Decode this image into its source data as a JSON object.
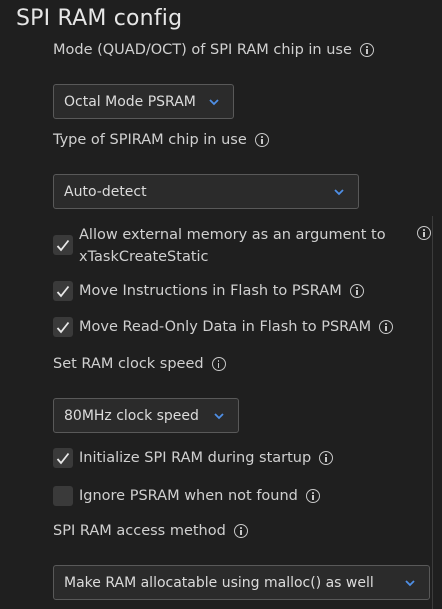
{
  "section_title": "SPI RAM config",
  "mode": {
    "label": "Mode (QUAD/OCT) of SPI RAM chip in use",
    "value": "Octal Mode PSRAM"
  },
  "chip_type": {
    "label": "Type of SPIRAM chip in use",
    "value": "Auto-detect"
  },
  "allow_external": {
    "label_line1": "Allow external memory as an argument to",
    "label_line2": "xTaskCreateStatic",
    "checked": true
  },
  "move_instructions": {
    "label": "Move Instructions in Flash to PSRAM",
    "checked": true
  },
  "move_rodata": {
    "label": "Move Read-Only Data in Flash to PSRAM",
    "checked": true
  },
  "clock_speed": {
    "label": "Set RAM clock speed",
    "value": "80MHz clock speed"
  },
  "init_spiram": {
    "label": "Initialize SPI RAM during startup",
    "checked": true
  },
  "ignore_psram": {
    "label": "Ignore PSRAM when not found",
    "checked": false
  },
  "access_method": {
    "label": "SPI RAM access method",
    "value": "Make RAM allocatable using malloc() as well"
  },
  "icons": {
    "info": "info-icon",
    "chevron": "chevron-down-icon",
    "check": "checkmark-icon"
  },
  "colors": {
    "background": "#1f1f1f",
    "chevron": "#4f8fe6",
    "checkbox_bg": "#3a3a3a"
  }
}
